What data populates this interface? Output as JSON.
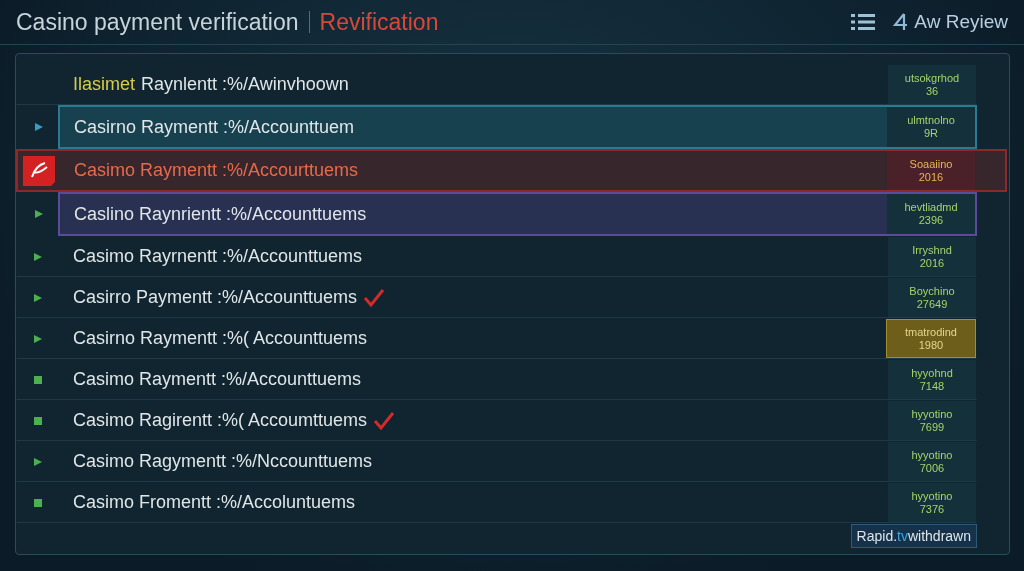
{
  "header": {
    "title": "Casino payment verification",
    "subtitle": "Revification",
    "review_label": "Aw Reyiew"
  },
  "rows": [
    {
      "lead": "Ilasimet",
      "label": "Raynlentt :%/Awinvhoown",
      "kind": "plain",
      "checked": false,
      "status": "utsokgrhod",
      "code": "36",
      "status_highlight": false
    },
    {
      "label": "Casirno Raymentt :%/Accounttuem",
      "kind": "arrow",
      "color": "#2a7a94",
      "checked": false,
      "status": "ulmtnolno",
      "code": "9R",
      "status_highlight": false
    },
    {
      "label": "Casimo Raymentt :%/Accourttuems",
      "kind": "flag",
      "color": "#8b2a2a",
      "checked": false,
      "status": "Soaaiino",
      "code": "2016",
      "status_highlight": false
    },
    {
      "label": "Caslino Raynrientt :%/Accounttuems",
      "kind": "arrow",
      "color": "#5a4c9a",
      "checked": false,
      "status": "hevtliadmd",
      "code": "2396",
      "status_highlight": false
    },
    {
      "label": "Casimo Rayrnentt :%/Accounttuems",
      "kind": "arrow",
      "checked": false,
      "status": "Irryshnd",
      "code": "2016",
      "status_highlight": false
    },
    {
      "label": "Casirro Paymentt :%/Accounttuems",
      "kind": "arrow",
      "checked": true,
      "status": "Boychino",
      "code": "27649",
      "status_highlight": false
    },
    {
      "label": "Casirno Raymentt :%( Accounttuems",
      "kind": "arrow",
      "checked": false,
      "status": "tmatrodind",
      "code": "1980",
      "status_highlight": true
    },
    {
      "label": "Casimo Raymentt :%/Accounttuems",
      "kind": "square",
      "checked": false,
      "status": "hyyohnd",
      "code": "7148",
      "status_highlight": false
    },
    {
      "label": "Casimo Ragirentt :%( Accoumttuems",
      "kind": "square",
      "checked": true,
      "status": "hyyotino",
      "code": "7699",
      "status_highlight": false
    },
    {
      "label": "Casimo Ragymentt :%/Nccounttuems",
      "kind": "arrow",
      "checked": false,
      "status": "hyyotino",
      "code": "7006",
      "status_highlight": false
    },
    {
      "label": "Casimo Fromentt :%/Accoluntuems",
      "kind": "square",
      "checked": false,
      "status": "hyyotino",
      "code": "7376",
      "status_highlight": false
    }
  ],
  "footer": {
    "button": "Rapid.",
    "button_accent": "tv",
    "button_rest": "withdrawn"
  }
}
